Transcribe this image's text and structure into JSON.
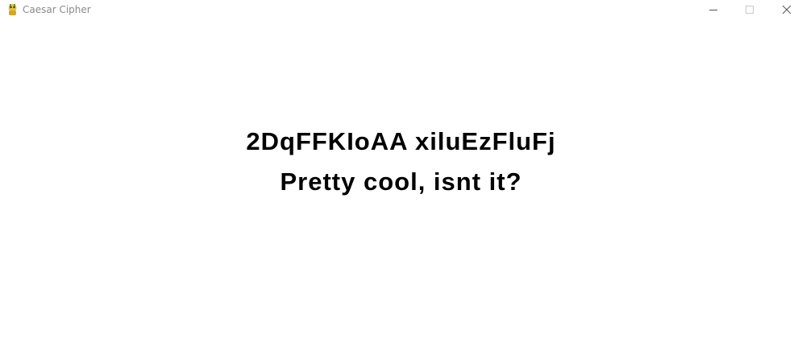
{
  "window": {
    "title": "Caesar Cipher",
    "app_icon": "pygame-snake-icon",
    "controls": {
      "minimize_icon": "minimize-icon",
      "maximize_icon": "maximize-icon",
      "close_icon": "close-icon"
    }
  },
  "main": {
    "cipher_text": "2DqFFKIoAA xiluEzFluFj",
    "message_text": "Pretty cool, isnt it?"
  },
  "colors": {
    "background": "#ffffff",
    "title_text": "#8a8a8a",
    "main_text": "#000000",
    "icon_yellow": "#e8c43a"
  }
}
